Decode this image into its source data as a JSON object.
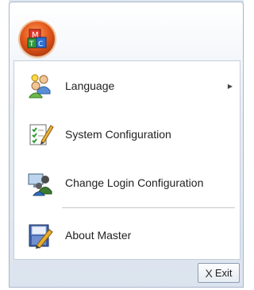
{
  "app_menu": {
    "orb_icon": "application-orb-logo",
    "orb_letters": [
      "M",
      "T",
      "C"
    ]
  },
  "menu": {
    "items": [
      {
        "label": "Language",
        "icon": "users-language-icon",
        "has_submenu": true,
        "submenu_arrow": "▶"
      },
      {
        "label": "System Configuration",
        "icon": "checklist-pencil-icon",
        "has_submenu": false
      },
      {
        "label": "Change Login Configuration",
        "icon": "users-computer-icon",
        "has_submenu": false
      },
      {
        "label": "About Master",
        "icon": "book-pencil-icon",
        "has_submenu": false
      }
    ]
  },
  "footer": {
    "exit_label": "Exit",
    "exit_icon": "close-x-icon",
    "exit_glyph": "X"
  }
}
